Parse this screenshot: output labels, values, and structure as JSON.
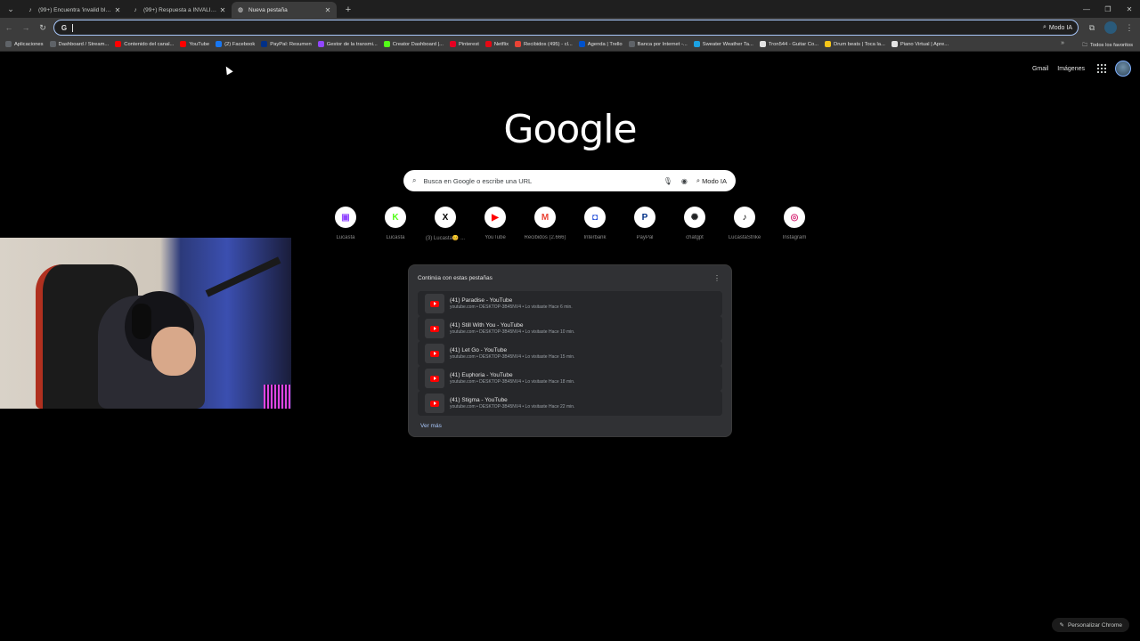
{
  "tabs": [
    {
      "title": "(99+) Encuentra 'invalid blood'",
      "favicon": "tiktok-icon"
    },
    {
      "title": "(99+) Respuesta a INVALIDAD",
      "favicon": "tiktok-icon"
    },
    {
      "title": "Nueva pestaña",
      "favicon": "chrome-icon",
      "active": true
    }
  ],
  "toolbar": {
    "omnibox_ai_mode": "Modo IA"
  },
  "bookmarks": [
    {
      "label": "Aplicaciones",
      "color": "#5f6368"
    },
    {
      "label": "Dashboard / Stream...",
      "color": "#5f6368"
    },
    {
      "label": "Contenido del canal...",
      "color": "#ff0000"
    },
    {
      "label": "YouTube",
      "color": "#ff0000"
    },
    {
      "label": "(2) Facebook",
      "color": "#1877f2"
    },
    {
      "label": "PayPal: Resumen",
      "color": "#003087"
    },
    {
      "label": "Gestor de la transmi...",
      "color": "#9146ff"
    },
    {
      "label": "Creator Dashboard |...",
      "color": "#53fc18"
    },
    {
      "label": "Pinterest",
      "color": "#e60023"
    },
    {
      "label": "Netflix",
      "color": "#e50914"
    },
    {
      "label": "Recibidos (495) - cl...",
      "color": "#ea4335"
    },
    {
      "label": "Agenda | Trello",
      "color": "#0052cc"
    },
    {
      "label": "Banca por Internet -...",
      "color": "#5f6368"
    },
    {
      "label": "Sweater Weather Ta...",
      "color": "#1ba1e2"
    },
    {
      "label": "Tron544 - Guitar Co...",
      "color": "#e3e3e3"
    },
    {
      "label": "Drum beats | Toca la...",
      "color": "#f5c518"
    },
    {
      "label": "Piano Virtual | Apre...",
      "color": "#e3e3e3"
    }
  ],
  "bookmarks_all": "Todos los favoritos",
  "ntp_links": {
    "gmail": "Gmail",
    "images": "Imágenes"
  },
  "logo": "Google",
  "search": {
    "placeholder": "Busca en Google o escribe una URL",
    "ai_mode": "Modo IA"
  },
  "shortcuts": [
    {
      "label": "Lucasta",
      "glyph": "▣",
      "color": "#9146ff"
    },
    {
      "label": "Lucasta",
      "glyph": "K",
      "color": "#53fc18"
    },
    {
      "label": "(3) Lucasta😊 ...",
      "glyph": "X",
      "color": "#000000"
    },
    {
      "label": "YouTube",
      "glyph": "▶",
      "color": "#ff0000"
    },
    {
      "label": "Recibidos (2.666)",
      "glyph": "M",
      "color": "#ea4335"
    },
    {
      "label": "Interbank",
      "glyph": "◘",
      "color": "#1f4bd8"
    },
    {
      "label": "PayPal",
      "glyph": "P",
      "color": "#003087"
    },
    {
      "label": "chatgpt",
      "glyph": "✺",
      "color": "#202123"
    },
    {
      "label": "LucastaStrike",
      "glyph": "♪",
      "color": "#000000"
    },
    {
      "label": "Instagram",
      "glyph": "◎",
      "color": "#d62976"
    }
  ],
  "continue_card": {
    "title": "Continúa con estas pestañas",
    "items": [
      {
        "title": "(41) Paradise - YouTube",
        "sub": "youtube.com • DESKTOP-3B45NV4 • Lo visitaste Hace 6 min."
      },
      {
        "title": "(41) Still With You - YouTube",
        "sub": "youtube.com • DESKTOP-3B45NV4 • Lo visitaste Hace 10 min."
      },
      {
        "title": "(41) Let Go - YouTube",
        "sub": "youtube.com • DESKTOP-3B45NV4 • Lo visitaste Hace 15 min."
      },
      {
        "title": "(41) Euphoria - YouTube",
        "sub": "youtube.com • DESKTOP-3B45NV4 • Lo visitaste Hace 18 min."
      },
      {
        "title": "(41) Stigma - YouTube",
        "sub": "youtube.com • DESKTOP-3B45NV4 • Lo visitaste Hace 22 min."
      }
    ],
    "more": "Ver más"
  },
  "customize": "Personalizar Chrome"
}
